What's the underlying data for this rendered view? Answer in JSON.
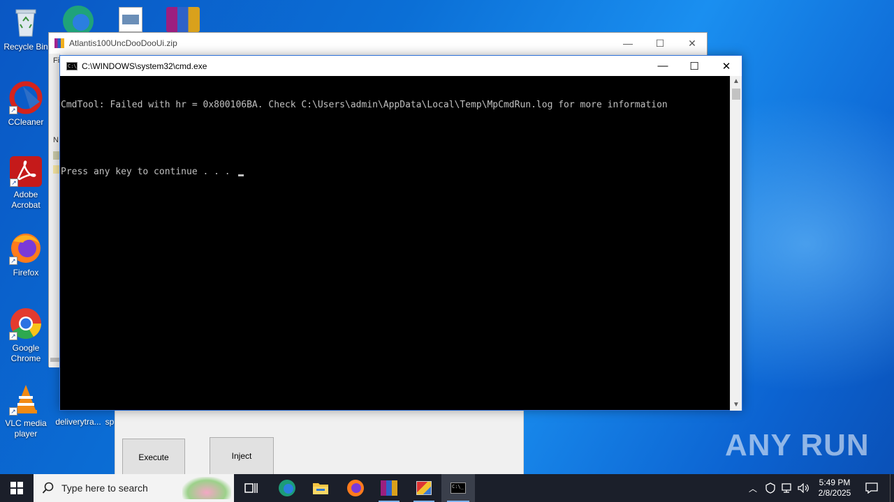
{
  "desktop": {
    "icons": [
      {
        "label": "Recycle Bin"
      },
      {
        "label": "CCleaner"
      },
      {
        "label": "Adobe Acrobat"
      },
      {
        "label": "Firefox"
      },
      {
        "label": "Google Chrome"
      },
      {
        "label": "VLC media player"
      },
      {
        "label": "deliverytra..."
      },
      {
        "label": "sp"
      }
    ]
  },
  "zip_window": {
    "title": "Atlantis100UncDooDooUi.zip",
    "side_letters": [
      "Fi",
      "N"
    ]
  },
  "app_panel": {
    "execute_label": "Execute",
    "inject_label": "Inject"
  },
  "cmd_window": {
    "title": "C:\\WINDOWS\\system32\\cmd.exe",
    "lines": [
      "CmdTool: Failed with hr = 0x800106BA. Check C:\\Users\\admin\\AppData\\Local\\Temp\\MpCmdRun.log for more information",
      "",
      "Press any key to continue . . . "
    ]
  },
  "watermark": {
    "text": "ANY RUN"
  },
  "taskbar": {
    "search_placeholder": "Type here to search",
    "time": "5:49 PM",
    "date": "2/8/2025",
    "icons": [
      "task-view-icon",
      "edge-icon",
      "file-explorer-icon",
      "firefox-icon",
      "winrar-icon",
      "app-icon",
      "cmd-icon"
    ]
  },
  "colors": {
    "taskbar": "#1b1f2a",
    "desktop_blue": "#0b6fd6",
    "cmd_text": "#c0c0c0"
  }
}
